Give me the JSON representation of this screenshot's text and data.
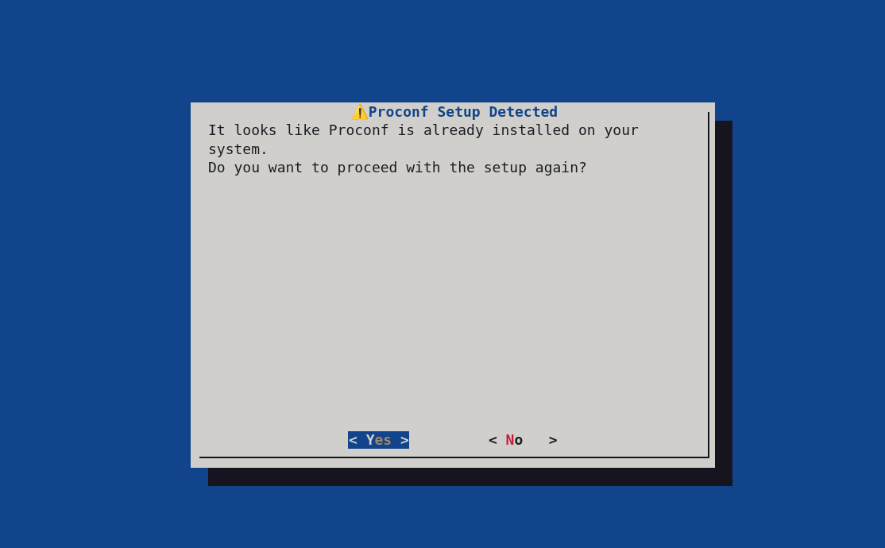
{
  "dialog": {
    "title": "⚠️Proconf Setup Detected",
    "message": [
      "It looks like Proconf is already installed on your",
      "system.",
      "Do you want to proceed with the setup again?"
    ],
    "buttons": [
      {
        "open": "<",
        "hotkey": "Y",
        "rest": "es",
        "close": ">",
        "selected": true
      },
      {
        "open": "<",
        "hotkey": "N",
        "rest": "o",
        "close": ">",
        "selected": false
      }
    ]
  }
}
